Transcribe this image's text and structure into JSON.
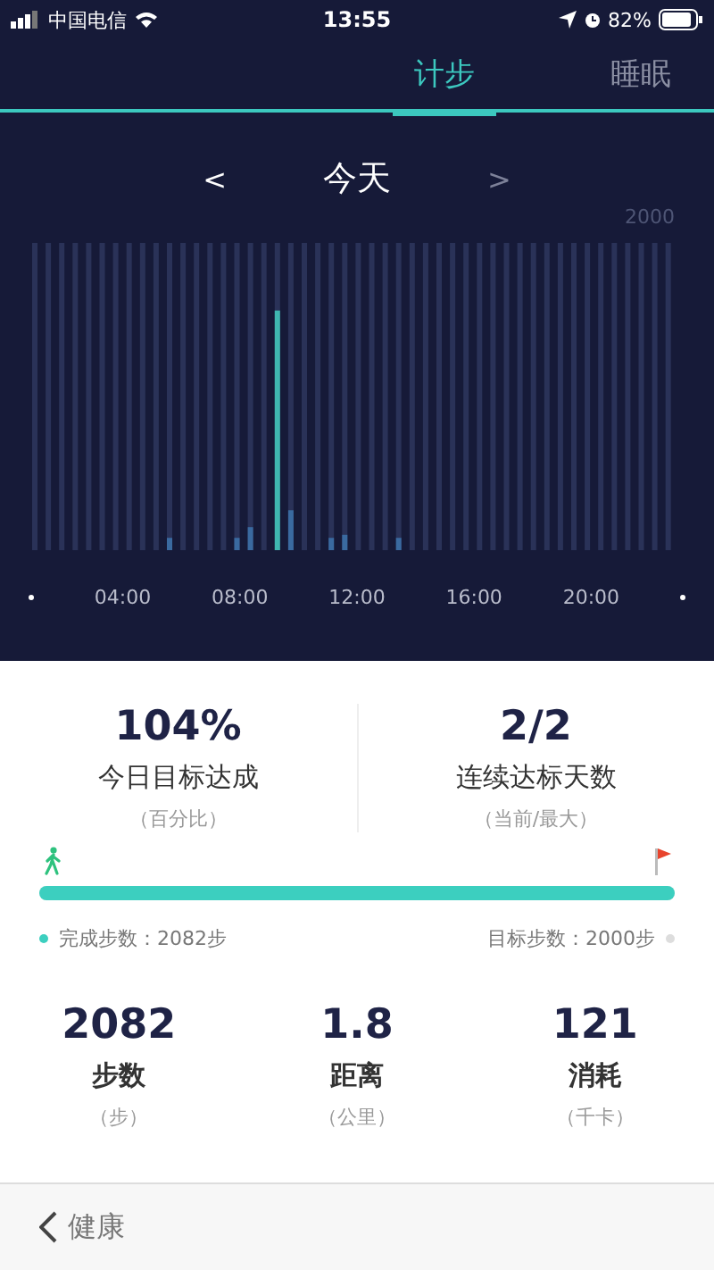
{
  "status_bar": {
    "carrier": "中国电信",
    "time": "13:55",
    "battery": "82%"
  },
  "tabs": [
    {
      "label": "计步",
      "selected": true
    },
    {
      "label": "睡眠",
      "selected": false
    }
  ],
  "date_nav": {
    "prev": {
      "label": "<",
      "disabled": false
    },
    "title": "今天",
    "next": {
      "label": ">",
      "disabled": true
    }
  },
  "chart": {
    "max_label": "2000",
    "x_labels": [
      "04:00",
      "08:00",
      "12:00",
      "16:00",
      "20:00"
    ]
  },
  "summary": [
    {
      "value": "104%",
      "label": "今日目标达成",
      "unit": "（百分比）"
    },
    {
      "value": "2/2",
      "label": "连续达标天数",
      "unit": "（当前/最大）"
    }
  ],
  "progress": {
    "level": 1,
    "completed": "完成步数：2082步",
    "target": "目标步数：2000步"
  },
  "metrics": [
    {
      "value": "2082",
      "label": "步数",
      "unit": "（步）"
    },
    {
      "value": "1.8",
      "label": "距离",
      "unit": "（公里）"
    },
    {
      "value": "121",
      "label": "消耗",
      "unit": "（千卡）"
    }
  ],
  "nav": {
    "back": "健康"
  }
}
